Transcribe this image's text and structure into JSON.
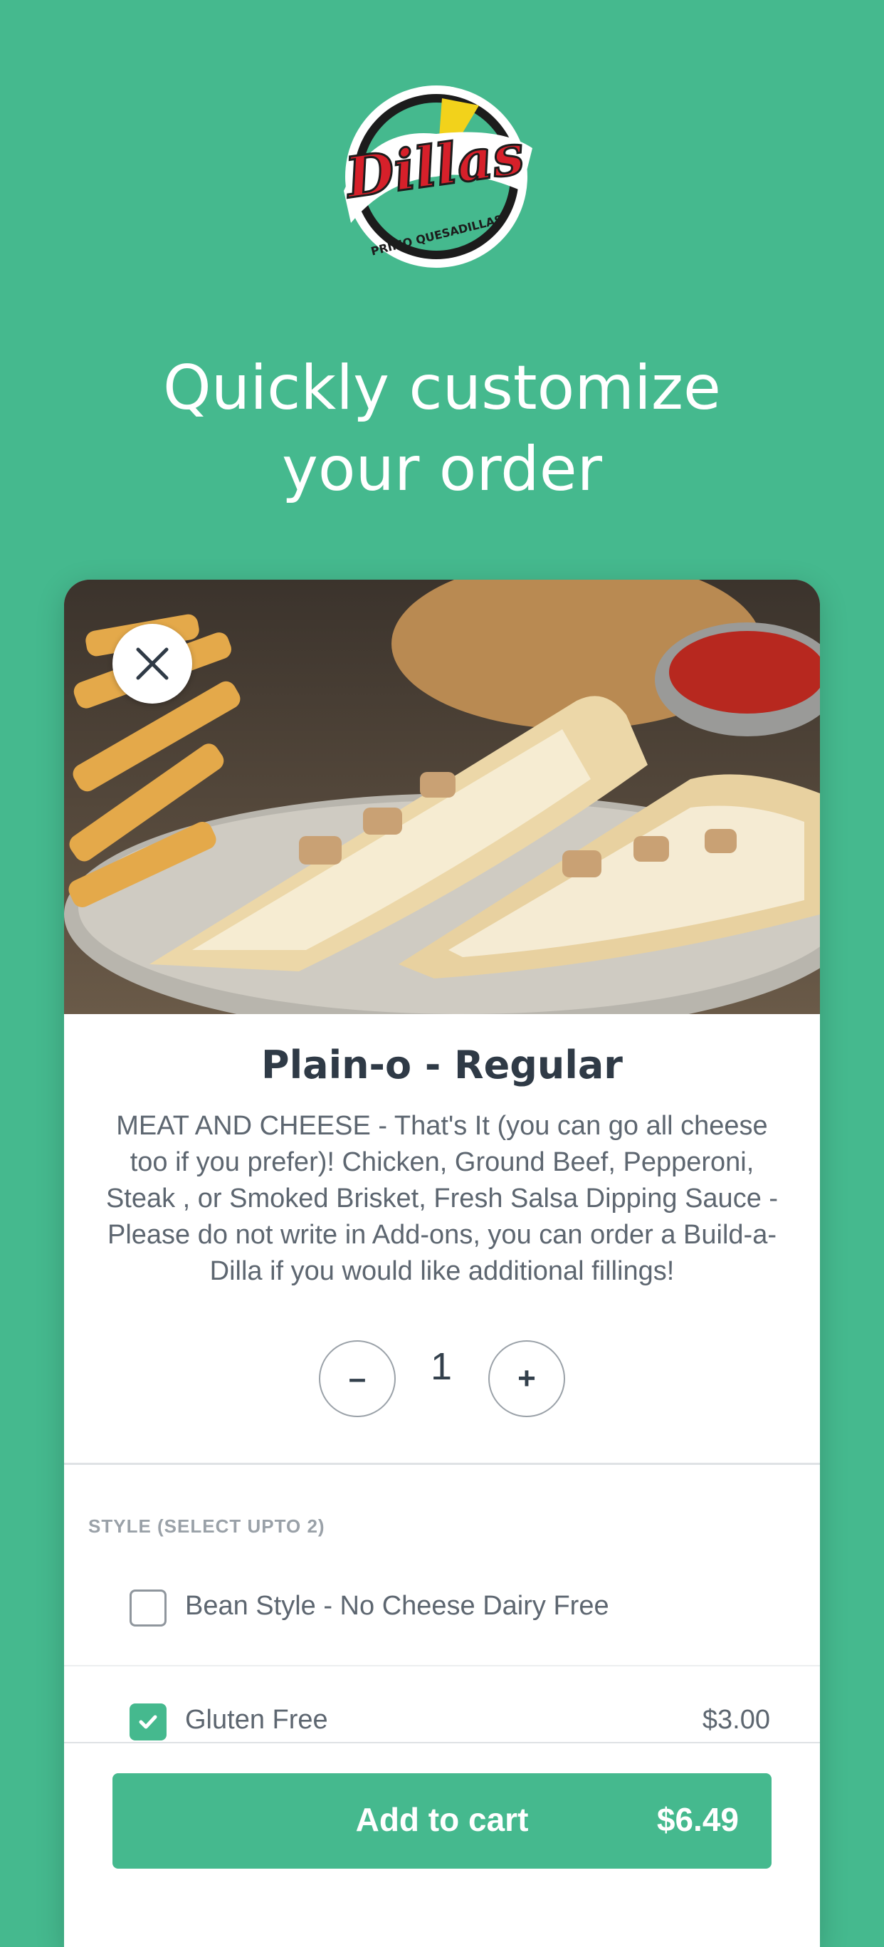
{
  "logo": {
    "brand_text": "Dillas",
    "tagline": "PRIMO QUESADILLAS"
  },
  "headline": {
    "line1": "Quickly customize",
    "line2": "your order"
  },
  "item": {
    "title": "Plain-o - Regular",
    "description": "MEAT AND CHEESE - That's It (you can go all cheese too if you prefer)! Chicken, Ground Beef, Pepperoni, Steak , or Smoked Brisket, Fresh Salsa Dipping Sauce - Please do not write in Add-ons, you can order a Build-a-Dilla if you would like additional fillings!",
    "quantity": "1",
    "minus_label": "–",
    "plus_label": "+"
  },
  "style_section": {
    "label": "STYLE (SELECT UPTO 2)",
    "options": [
      {
        "label": "Bean Style - No Cheese Dairy Free",
        "price": "",
        "checked": false
      },
      {
        "label": "Gluten Free",
        "price": "$3.00",
        "checked": true
      }
    ]
  },
  "footer": {
    "add_to_cart_label": "Add to cart",
    "total": "$6.49"
  },
  "colors": {
    "brand_green": "#45b98e",
    "title_text": "#2f3a46",
    "body_text": "#5d6670",
    "muted_label": "#9aa1a8"
  },
  "icons": {
    "close": "close-icon",
    "check": "checkmark-icon"
  }
}
